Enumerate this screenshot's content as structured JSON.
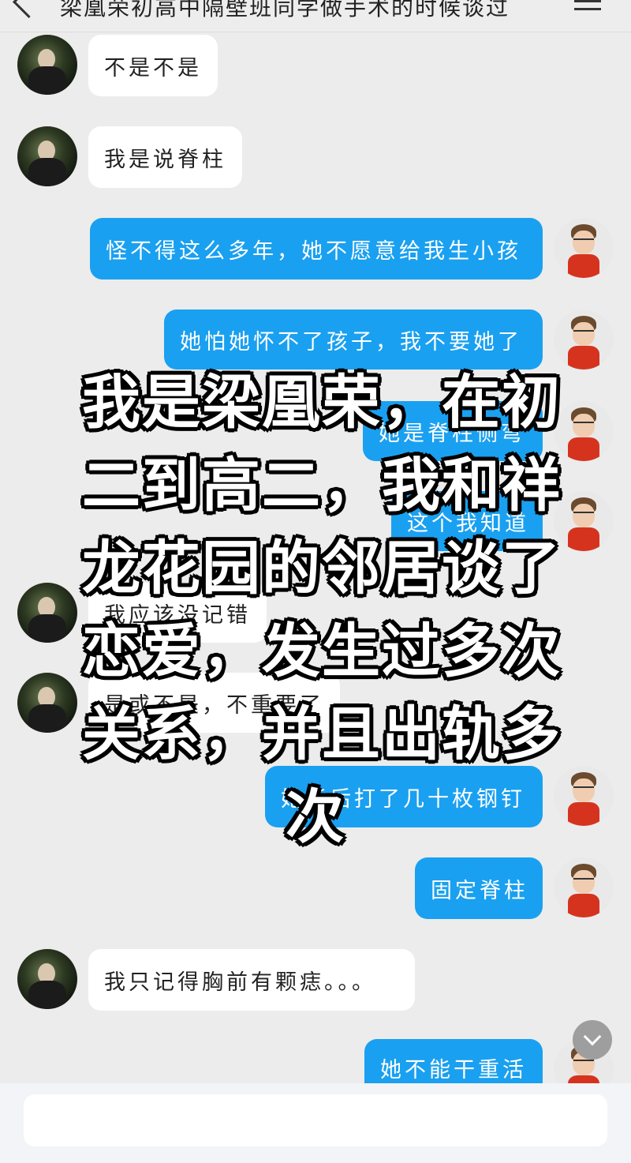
{
  "header": {
    "title": "梁凰荣初高中隔壁班同学做手术的时候谈过",
    "back_icon": "back-chevron-icon",
    "menu_icon": "menu-icon"
  },
  "messages": [
    {
      "side": "left",
      "text": "不是不是"
    },
    {
      "side": "left",
      "text": "我是说脊柱"
    },
    {
      "side": "right",
      "text": "怪不得这么多年，她不愿意给我生小孩"
    },
    {
      "side": "right",
      "text": "她怕她怀不了孩子，我不要她了"
    },
    {
      "side": "right",
      "text": "她是脊柱侧弯"
    },
    {
      "side": "right",
      "text": "这个我知道"
    },
    {
      "side": "left",
      "text": "我应该没记错"
    },
    {
      "side": "left",
      "text": "是或不是，不重要了"
    },
    {
      "side": "right",
      "text": "她背后打了几十枚钢钉"
    },
    {
      "side": "right",
      "text": "固定脊柱"
    },
    {
      "side": "left",
      "text": "我只记得胸前有颗痣。。。"
    },
    {
      "side": "right",
      "text": "她不能干重活"
    }
  ],
  "overlay": {
    "lines": [
      "我是梁凰荣，在初",
      "二到高二，我和祥",
      "龙花园的邻居谈了",
      "恋爱，发生过多次",
      "关系，并且出轨多",
      "次"
    ]
  },
  "colors": {
    "background": "#ececec",
    "outgoing_bubble": "#1aa0f0",
    "incoming_bubble": "#ffffff"
  },
  "icons": {
    "scroll_down": "chevron-down-icon"
  }
}
